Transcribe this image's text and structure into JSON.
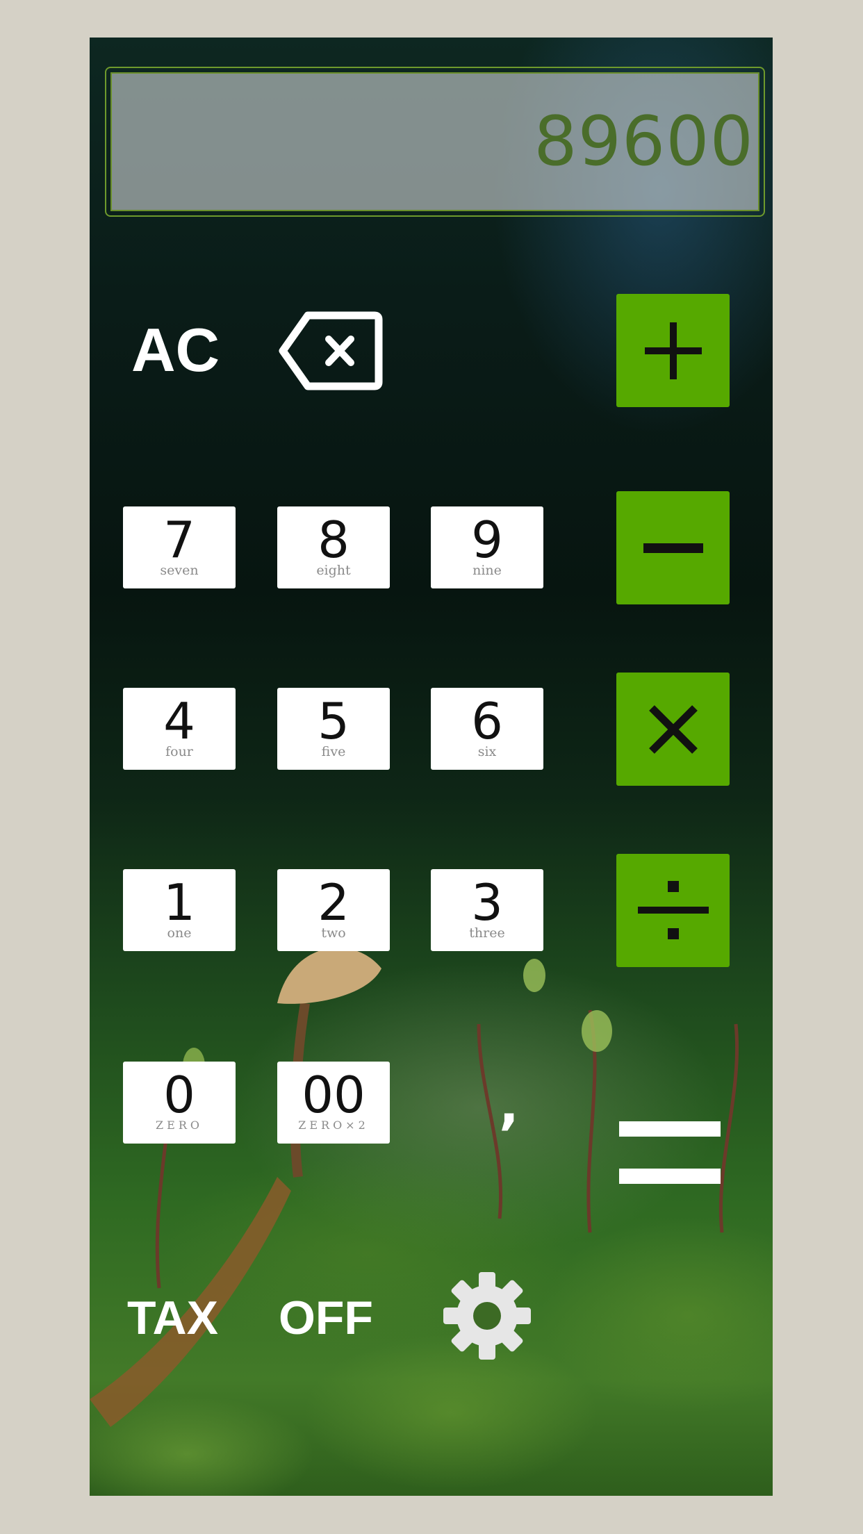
{
  "display": {
    "value": "89600"
  },
  "controls": {
    "all_clear_label": "AC",
    "backspace_icon": "backspace-icon"
  },
  "keys": [
    {
      "digit": "7",
      "word": "seven"
    },
    {
      "digit": "8",
      "word": "eight"
    },
    {
      "digit": "9",
      "word": "nine"
    },
    {
      "digit": "4",
      "word": "four"
    },
    {
      "digit": "5",
      "word": "five"
    },
    {
      "digit": "6",
      "word": "six"
    },
    {
      "digit": "1",
      "word": "one"
    },
    {
      "digit": "2",
      "word": "two"
    },
    {
      "digit": "3",
      "word": "three"
    },
    {
      "digit": "0",
      "word": "ZERO"
    },
    {
      "digit": "00",
      "word": "ZERO×2"
    }
  ],
  "operators": [
    "plus-icon",
    "minus-icon",
    "multiply-icon",
    "divide-icon",
    "equals-icon"
  ],
  "comma_label": "’",
  "footer": {
    "tax_label": "TAX",
    "tax_state": "OFF",
    "settings_icon": "gear-icon"
  },
  "colors": {
    "accent": "#56a900",
    "display_text": "#4a6d2a",
    "page_bg": "#d5d1c6"
  }
}
